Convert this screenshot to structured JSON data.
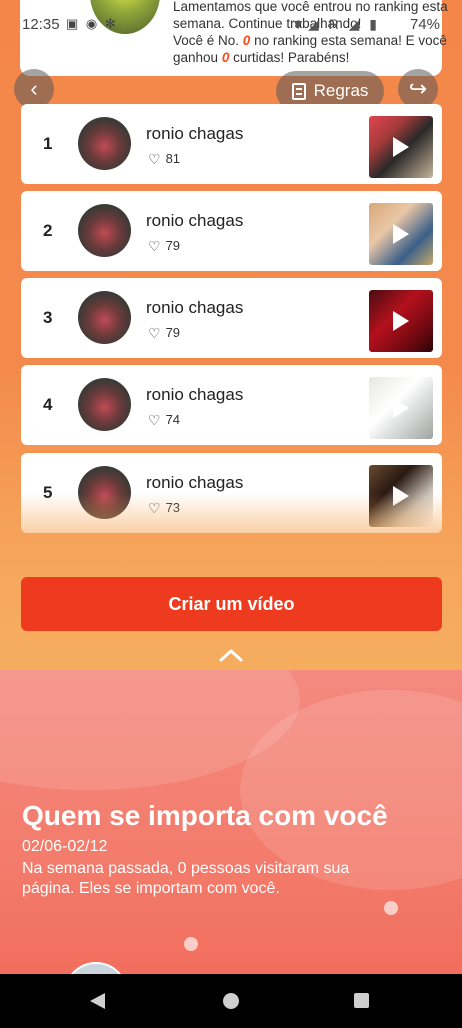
{
  "status_bar": {
    "time": "12:35",
    "notification_icons": "▣ ◉ ✻",
    "signal_icons": "▼◢ R ◢ ▮",
    "battery": "74%"
  },
  "banner": {
    "line1": "Lamentamos que você entrou no ranking esta semana. Continue trabalhando!",
    "line2_pre": "Você é No. ",
    "rank": "0",
    "line2_mid": " no ranking esta semana! E você ganhou ",
    "likes": "0",
    "line2_post": " curtidas! Parabéns!"
  },
  "toolbar": {
    "back_icon": "‹",
    "rules_label": "Regras",
    "share_icon": "↪"
  },
  "ranking": [
    {
      "num": "1",
      "name": "ronio chagas",
      "likes": "81"
    },
    {
      "num": "2",
      "name": "ronio chagas",
      "likes": "79"
    },
    {
      "num": "3",
      "name": "ronio chagas",
      "likes": "79"
    },
    {
      "num": "4",
      "name": "ronio chagas",
      "likes": "74"
    },
    {
      "num": "5",
      "name": "ronio chagas",
      "likes": "73"
    }
  ],
  "heart_icon": "♡",
  "create_button": "Criar um vídeo",
  "care_section": {
    "title": "Quem se importa com você",
    "date_range": "02/06-02/12",
    "description": "Na semana passada, 0 pessoas visitaram sua página. Eles se importam com você."
  },
  "colors": {
    "accent": "#ee3a1e",
    "highlight": "#ff4a1a",
    "orange_bg": "#f4864a",
    "pink_bg": "#f37c6c"
  }
}
